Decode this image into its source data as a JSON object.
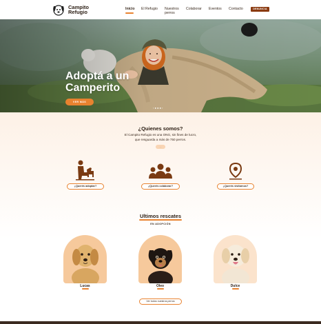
{
  "brand": {
    "line1": "Campito",
    "line2": "Refugio"
  },
  "nav": {
    "items": [
      "Inicio",
      "El Refugio",
      "Nuestros perros",
      "Colaborar",
      "Eventos",
      "Contacto"
    ],
    "nuestros_line1": "Nuestros",
    "nuestros_line2": "perros",
    "denuncia": "DENUNCIA"
  },
  "hero": {
    "title_line1": "Adoptá a un",
    "title_line2": "Camperito",
    "button": "VER MÁS",
    "pager": "‹ ● ● ● ›"
  },
  "about": {
    "title": "¿Quienes somos?",
    "text": "El Campito Refugio es una ONG, sin fines de lucro, que resguarda a más de 750 perros.",
    "pill": "···"
  },
  "features": [
    {
      "icon": "adopt-person-dog-icon",
      "label": "¿Querés adoptar?"
    },
    {
      "icon": "group-people-icon",
      "label": "¿Querés colaborar?"
    },
    {
      "icon": "location-pin-icon",
      "label": "¿Querés visitarnos?"
    }
  ],
  "rescues": {
    "title": "Ultimos rescates",
    "subtitle": "EN ADOPCIÓN",
    "dogs": [
      {
        "name": "Lucas"
      },
      {
        "name": "Oleo"
      },
      {
        "name": "Dulce"
      }
    ],
    "all_button": "Ver todos nuestros perros"
  },
  "colors": {
    "accent": "#e8822f",
    "dark": "#3b2a20",
    "denuncia": "#8a3a10",
    "card_bg": "#f6c99c"
  }
}
